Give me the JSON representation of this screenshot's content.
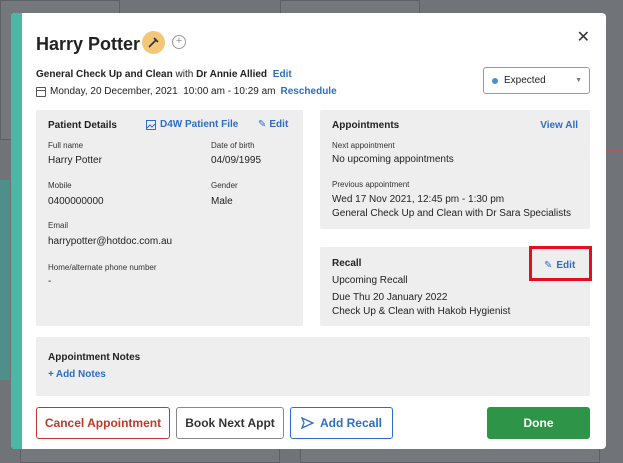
{
  "modal": {
    "title": "Harry Potter",
    "appointment_type": "General Check Up and Clean",
    "with_word": "with",
    "practitioner": "Dr Annie Allied",
    "edit_label": "Edit",
    "datetime": "Monday, 20 December, 2021  10:00 am - 10:29 am",
    "reschedule_label": "Reschedule",
    "status": "Expected"
  },
  "patient": {
    "header": "Patient Details",
    "d4w_label": "D4W Patient File",
    "edit_label": "Edit",
    "full_name_label": "Full name",
    "full_name": "Harry Potter",
    "dob_label": "Date of birth",
    "dob": "04/09/1995",
    "mobile_label": "Mobile",
    "mobile": "0400000000",
    "gender_label": "Gender",
    "gender": "Male",
    "email_label": "Email",
    "email": "harrypotter@hotdoc.com.au",
    "alt_phone_label": "Home/alternate phone number",
    "alt_phone": "-"
  },
  "appointments": {
    "header": "Appointments",
    "view_all": "View All",
    "next_label": "Next appointment",
    "next_value": "No upcoming appointments",
    "prev_label": "Previous appointment",
    "prev_datetime": "Wed 17 Nov 2021, 12:45 pm - 1:30 pm",
    "prev_detail": "General Check Up and Clean with Dr Sara Specialists"
  },
  "recall": {
    "header": "Recall",
    "edit_label": "Edit",
    "upcoming": "Upcoming Recall",
    "due": "Due Thu 20 January 2022",
    "detail": "Check Up & Clean with Hakob Hygienist"
  },
  "notes": {
    "header": "Appointment Notes",
    "add_label": "Add Notes"
  },
  "footer": {
    "cancel": "Cancel Appointment",
    "book_next": "Book Next Appt",
    "add_recall": "Add Recall",
    "done": "Done"
  },
  "colors": {
    "accent": "#4cb7a5",
    "link": "#2d6ec9",
    "cancel": "#c0392b",
    "done": "#2e9448",
    "highlight": "#e3101c"
  }
}
